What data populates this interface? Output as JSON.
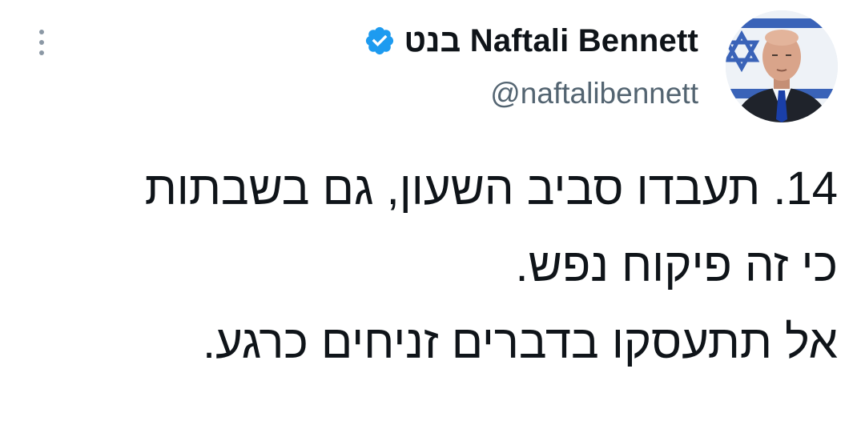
{
  "tweet": {
    "author": {
      "display_name": "בנט Naftali Bennett",
      "handle": "@naftalibennett",
      "verified": true,
      "avatar_icon": "profile-photo-israel-flag"
    },
    "text_lines": [
      "14. תעבדו סביב השעון, גם בשבתות",
      "כי זה פיקוח נפש.",
      "אל תתעסקו בדברים זניחים כרגע."
    ],
    "icons": {
      "more": "more-vertical-icon",
      "verified": "verified-badge-icon"
    },
    "colors": {
      "verified_blue": "#1d9bf0",
      "text": "#0f1419",
      "secondary_text": "#536471",
      "more_dots": "#8b98a5"
    }
  }
}
